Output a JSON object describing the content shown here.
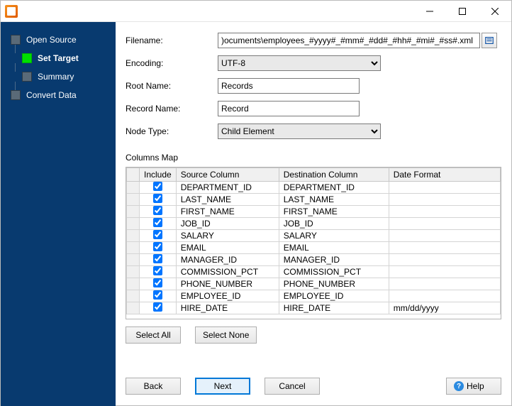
{
  "window": {
    "title": ""
  },
  "sidebar": {
    "items": [
      {
        "label": "Open Source",
        "active": false,
        "sub": false
      },
      {
        "label": "Set Target",
        "active": true,
        "sub": true
      },
      {
        "label": "Summary",
        "active": false,
        "sub": true
      },
      {
        "label": "Convert Data",
        "active": false,
        "sub": false
      }
    ]
  },
  "form": {
    "filename_label": "Filename:",
    "filename_value": ")ocuments\\employees_#yyyy#_#mm#_#dd#_#hh#_#mi#_#ss#.xml",
    "encoding_label": "Encoding:",
    "encoding_value": "UTF-8",
    "rootname_label": "Root Name:",
    "rootname_value": "Records",
    "recordname_label": "Record Name:",
    "recordname_value": "Record",
    "nodetype_label": "Node Type:",
    "nodetype_value": "Child Element"
  },
  "columns_map": {
    "section_label": "Columns Map",
    "headers": {
      "include": "Include",
      "source": "Source Column",
      "destination": "Destination Column",
      "dateformat": "Date Format"
    },
    "rows": [
      {
        "include": true,
        "source": "DEPARTMENT_ID",
        "destination": "DEPARTMENT_ID",
        "dateformat": ""
      },
      {
        "include": true,
        "source": "LAST_NAME",
        "destination": "LAST_NAME",
        "dateformat": ""
      },
      {
        "include": true,
        "source": "FIRST_NAME",
        "destination": "FIRST_NAME",
        "dateformat": ""
      },
      {
        "include": true,
        "source": "JOB_ID",
        "destination": "JOB_ID",
        "dateformat": ""
      },
      {
        "include": true,
        "source": "SALARY",
        "destination": "SALARY",
        "dateformat": ""
      },
      {
        "include": true,
        "source": "EMAIL",
        "destination": "EMAIL",
        "dateformat": ""
      },
      {
        "include": true,
        "source": "MANAGER_ID",
        "destination": "MANAGER_ID",
        "dateformat": ""
      },
      {
        "include": true,
        "source": "COMMISSION_PCT",
        "destination": "COMMISSION_PCT",
        "dateformat": ""
      },
      {
        "include": true,
        "source": "PHONE_NUMBER",
        "destination": "PHONE_NUMBER",
        "dateformat": ""
      },
      {
        "include": true,
        "source": "EMPLOYEE_ID",
        "destination": "EMPLOYEE_ID",
        "dateformat": ""
      },
      {
        "include": true,
        "source": "HIRE_DATE",
        "destination": "HIRE_DATE",
        "dateformat": "mm/dd/yyyy"
      }
    ]
  },
  "buttons": {
    "select_all": "Select All",
    "select_none": "Select None",
    "back": "Back",
    "next": "Next",
    "cancel": "Cancel",
    "help": "Help"
  }
}
